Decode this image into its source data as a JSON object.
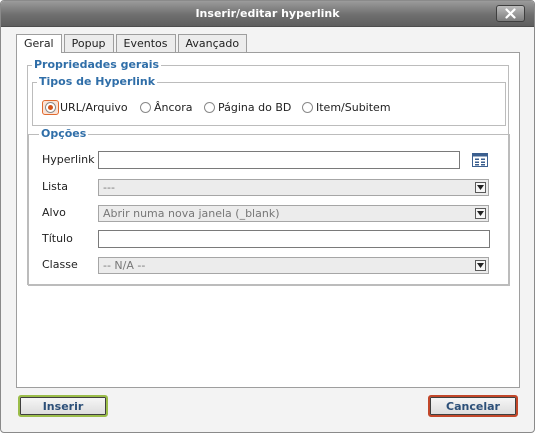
{
  "window": {
    "title": "Inserir/editar hyperlink"
  },
  "tabs": [
    {
      "label": "Geral",
      "active": true
    },
    {
      "label": "Popup",
      "active": false
    },
    {
      "label": "Eventos",
      "active": false
    },
    {
      "label": "Avançado",
      "active": false
    }
  ],
  "general": {
    "legend": "Propriedades gerais",
    "link_type": {
      "legend": "Tipos de Hyperlink",
      "options": [
        {
          "label": "URL/Arquivo",
          "checked": true
        },
        {
          "label": "Âncora",
          "checked": false
        },
        {
          "label": "Página do BD",
          "checked": false
        },
        {
          "label": "Item/Subitem",
          "checked": false
        }
      ]
    },
    "options": {
      "legend": "Opções",
      "hyperlink": {
        "label": "Hyperlink",
        "value": ""
      },
      "lista": {
        "label": "Lista",
        "value": "---"
      },
      "alvo": {
        "label": "Alvo",
        "value": "Abrir numa nova janela (_blank)"
      },
      "titulo": {
        "label": "Título",
        "value": ""
      },
      "classe": {
        "label": "Classe",
        "value": "-- N/A --"
      }
    }
  },
  "buttons": {
    "insert": "Inserir",
    "cancel": "Cancelar"
  },
  "colors": {
    "legend": "#2f6ea8",
    "insert_border": "#9bbd4a",
    "cancel_border": "#c2472a",
    "radio_selected": "#d2541b"
  },
  "icons": {
    "close": "close-icon",
    "browse": "browse-list-icon",
    "dropdown": "chevron-down-icon"
  }
}
